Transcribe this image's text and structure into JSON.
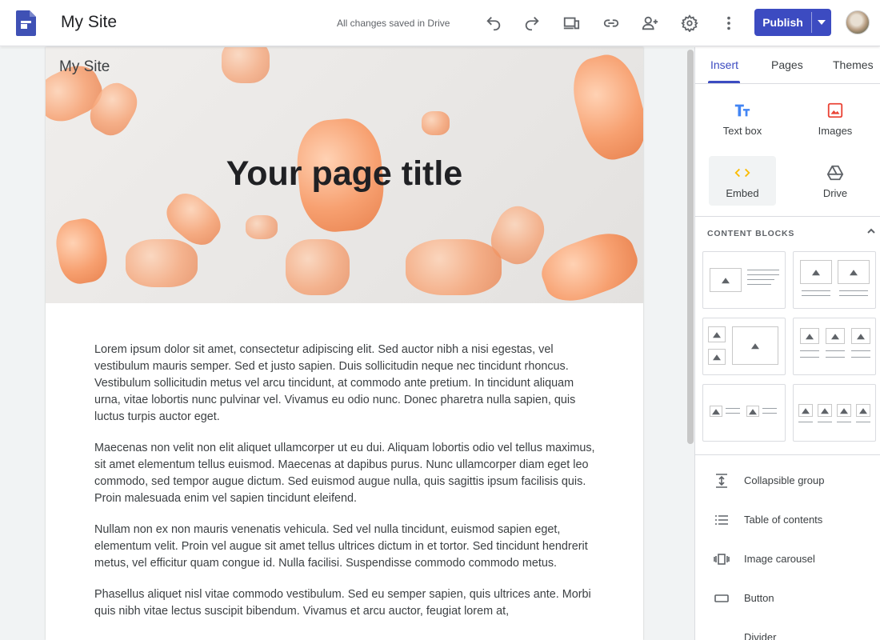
{
  "topbar": {
    "site_name": "My Site",
    "save_status": "All changes saved in Drive",
    "publish_label": "Publish",
    "icons": [
      "undo-icon",
      "redo-icon",
      "preview-icon",
      "link-icon",
      "share-icon",
      "settings-icon",
      "more-icon"
    ]
  },
  "page": {
    "header_site_name": "My Site",
    "title": "Your page title",
    "paragraphs": [
      "Lorem ipsum dolor sit amet, consectetur adipiscing elit. Sed auctor nibh a nisi egestas, vel vestibulum mauris semper. Sed et justo sapien. Duis sollicitudin neque nec tincidunt rhoncus. Vestibulum sollicitudin metus vel arcu tincidunt, at commodo ante pretium. In tincidunt aliquam urna, vitae lobortis nunc pulvinar vel. Vivamus eu odio nunc. Donec pharetra nulla sapien, quis luctus turpis auctor eget.",
      "Maecenas non velit non elit aliquet ullamcorper ut eu dui. Aliquam lobortis odio vel tellus maximus, sit amet elementum tellus euismod. Maecenas at dapibus purus. Nunc ullamcorper diam eget leo commodo, sed tempor augue dictum. Sed euismod augue nulla, quis sagittis ipsum facilisis quis. Proin malesuada enim vel sapien tincidunt eleifend.",
      "Nullam non ex non mauris venenatis vehicula. Sed vel nulla tincidunt, euismod sapien eget, elementum velit. Proin vel augue sit amet tellus ultrices dictum in et tortor. Sed tincidunt hendrerit metus, vel efficitur quam congue id. Nulla facilisi. Suspendisse commodo commodo metus.",
      "Phasellus aliquet nisl vitae commodo vestibulum. Sed eu semper sapien, quis ultrices ante. Morbi quis nibh vitae lectus suscipit bibendum. Vivamus et arcu auctor, feugiat lorem at,"
    ]
  },
  "panel": {
    "tabs": [
      {
        "label": "Insert",
        "active": true
      },
      {
        "label": "Pages",
        "active": false
      },
      {
        "label": "Themes",
        "active": false
      }
    ],
    "tools": [
      {
        "label": "Text box",
        "icon": "text-box-icon",
        "color": "#4285f4"
      },
      {
        "label": "Images",
        "icon": "images-icon",
        "color": "#ea4335"
      },
      {
        "label": "Embed",
        "icon": "embed-icon",
        "color": "#fbbc04"
      },
      {
        "label": "Drive",
        "icon": "drive-icon",
        "color": "#5f6368"
      }
    ],
    "content_blocks_heading": "CONTENT BLOCKS",
    "items": [
      {
        "label": "Collapsible group",
        "icon": "collapsible-group-icon"
      },
      {
        "label": "Table of contents",
        "icon": "table-of-contents-icon"
      },
      {
        "label": "Image carousel",
        "icon": "image-carousel-icon"
      },
      {
        "label": "Button",
        "icon": "button-icon"
      },
      {
        "label": "Divider",
        "icon": "divider-icon"
      }
    ]
  },
  "colors": {
    "accent": "#3c4bc1",
    "publish": "#3c4bc1"
  }
}
